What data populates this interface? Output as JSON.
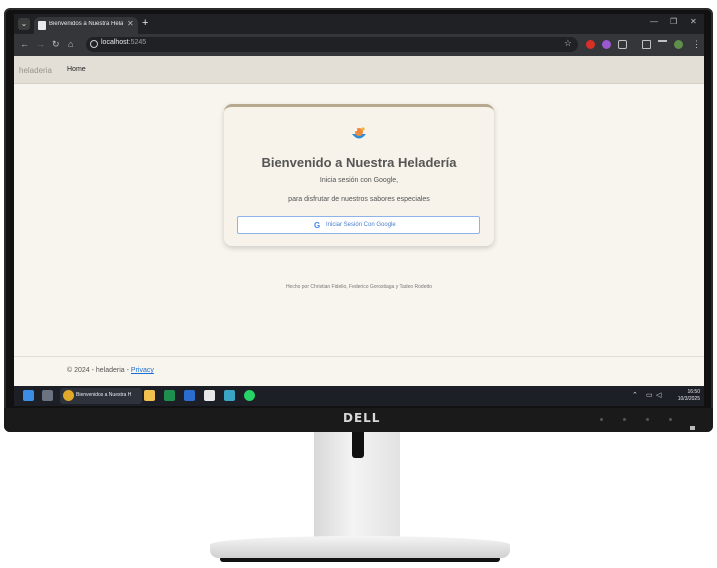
{
  "monitor": {
    "brand": "DELL"
  },
  "browser": {
    "tab_title": "Bienvenidos a Nuestra Helader",
    "url_host": "localhost",
    "url_port": ":5245"
  },
  "page": {
    "navbar": {
      "brand": "heladeria",
      "home": "Home"
    },
    "card": {
      "title": "Bienvenido a Nuestra Heladería",
      "line1": "Inicia sesión con Google,",
      "line2": "para disfrutar de nuestros sabores especiales",
      "button_label": "Iniciar Sesión Con Google",
      "google_glyph": "G"
    },
    "credits": "Hecho por Christian Fidelio, Federico Gorostiaga y Tadeo Rodetto",
    "footer": {
      "text": "© 2024 - heladeria - ",
      "privacy": "Privacy"
    }
  },
  "taskbar": {
    "chrome_label": "Bienvenidos a Nuestra H",
    "time": "16:50",
    "date": "10/3/2025"
  },
  "icons": {
    "accent": "#b7a98f",
    "google_blue": "#4285f4",
    "link_blue": "#1a6fd0"
  }
}
